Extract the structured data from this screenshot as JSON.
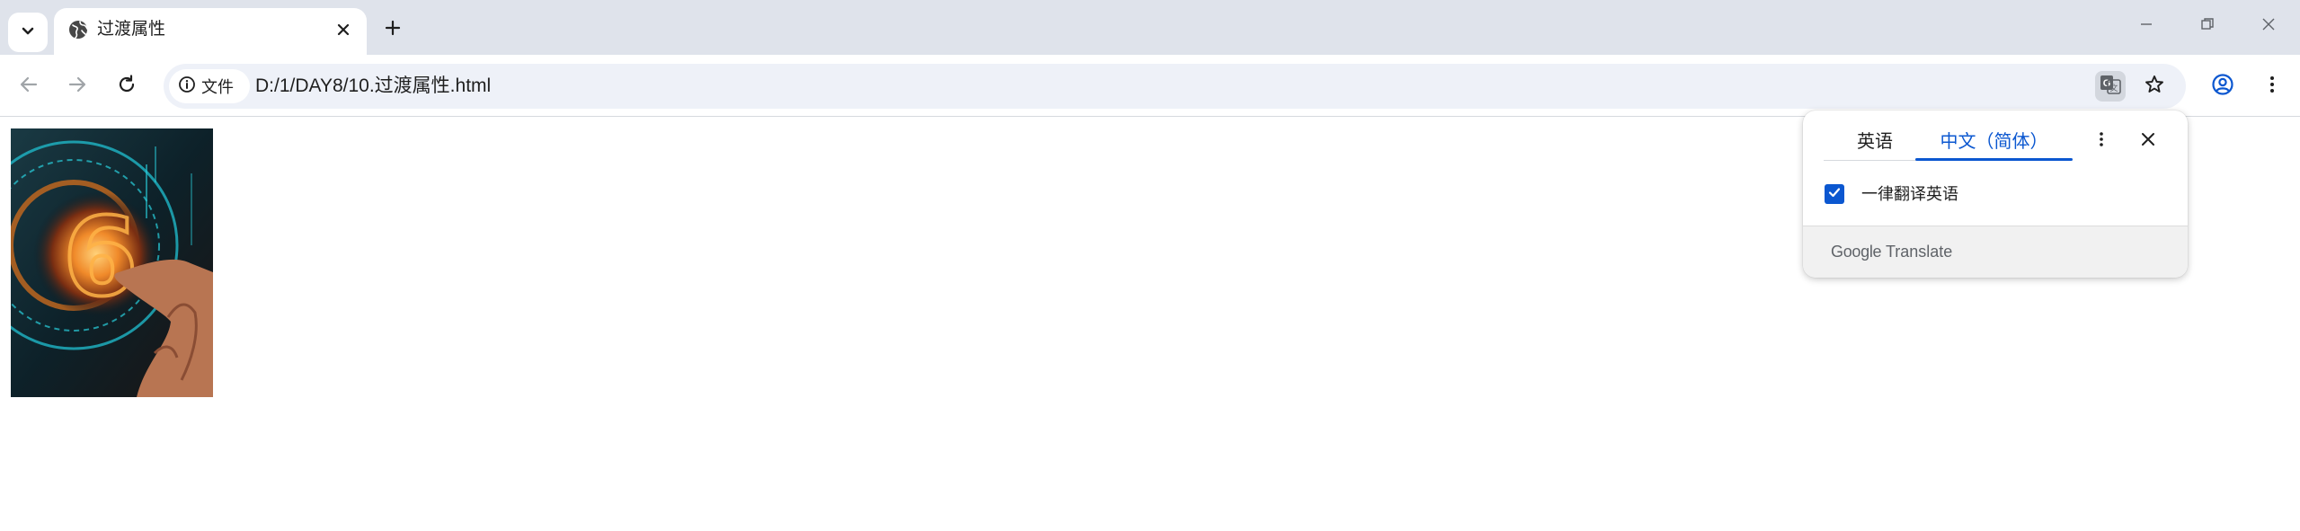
{
  "browser": {
    "tab": {
      "title": "过渡属性",
      "favicon": "globe-icon"
    },
    "toolbar": {
      "site_info_label": "文件",
      "url": "D:/1/DAY8/10.过渡属性.html"
    }
  },
  "translate_popup": {
    "source_language": "英语",
    "target_language": "中文（简体）",
    "always_translate_label": "一律翻译英语",
    "always_translate_checked": true,
    "brand_google": "Google",
    "brand_translate": "Translate"
  },
  "page": {
    "image_description_icon": "image"
  },
  "colors": {
    "tabbar_bg": "#dfe3eb",
    "omnibox_bg": "#eef1f8",
    "accent": "#0b57d0"
  }
}
